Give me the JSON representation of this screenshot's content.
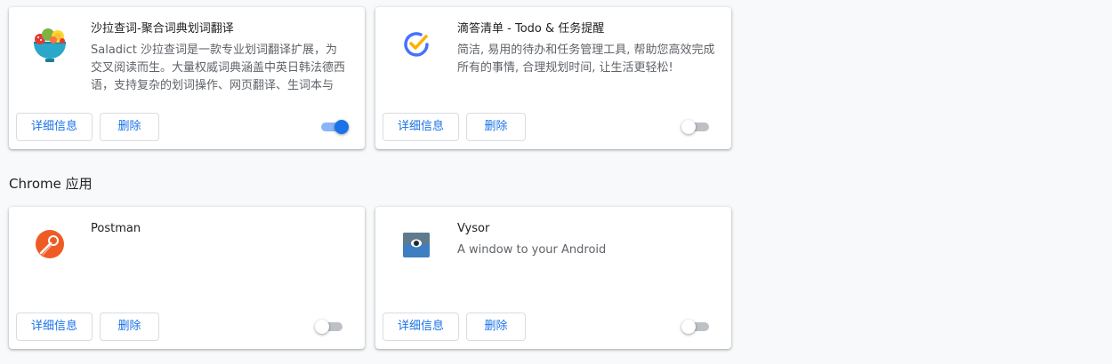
{
  "extensions": [
    {
      "title": "沙拉查词-聚合词典划词翻译",
      "description": "Saladict 沙拉查词是一款专业划词翻译扩展，为交叉阅读而生。大量权威词典涵盖中英日韩法德西语，支持复杂的划词操作、网页翻译、生词本与",
      "details_label": "详细信息",
      "remove_label": "删除",
      "enabled": true,
      "icon": "saladict-bowl-icon"
    },
    {
      "title": "滴答清单 - Todo & 任务提醒",
      "description": "简洁, 易用的待办和任务管理工具, 帮助您高效完成所有的事情, 合理规划时间, 让生活更轻松!",
      "details_label": "详细信息",
      "remove_label": "删除",
      "enabled": false,
      "icon": "ticktick-check-icon"
    }
  ],
  "chrome_apps": {
    "section_title": "Chrome 应用",
    "items": [
      {
        "title": "Postman",
        "description": "",
        "details_label": "详细信息",
        "remove_label": "删除",
        "enabled": false,
        "icon": "postman-logo-icon"
      },
      {
        "title": "Vysor",
        "description": "A window to your Android",
        "details_label": "详细信息",
        "remove_label": "删除",
        "enabled": false,
        "icon": "vysor-eye-icon"
      }
    ]
  },
  "colors": {
    "accent": "#1a73e8",
    "background": "#f8f9fa",
    "toggle_off_track": "#bdc1c6",
    "toggle_on_track": "#8ab4f8",
    "postman_orange": "#ef5b25",
    "ticktick_blue": "#4772fa",
    "ticktick_yellow": "#ffb000",
    "vysor_gray": "#5f7a8c",
    "vysor_blue": "#3d7fc1"
  }
}
